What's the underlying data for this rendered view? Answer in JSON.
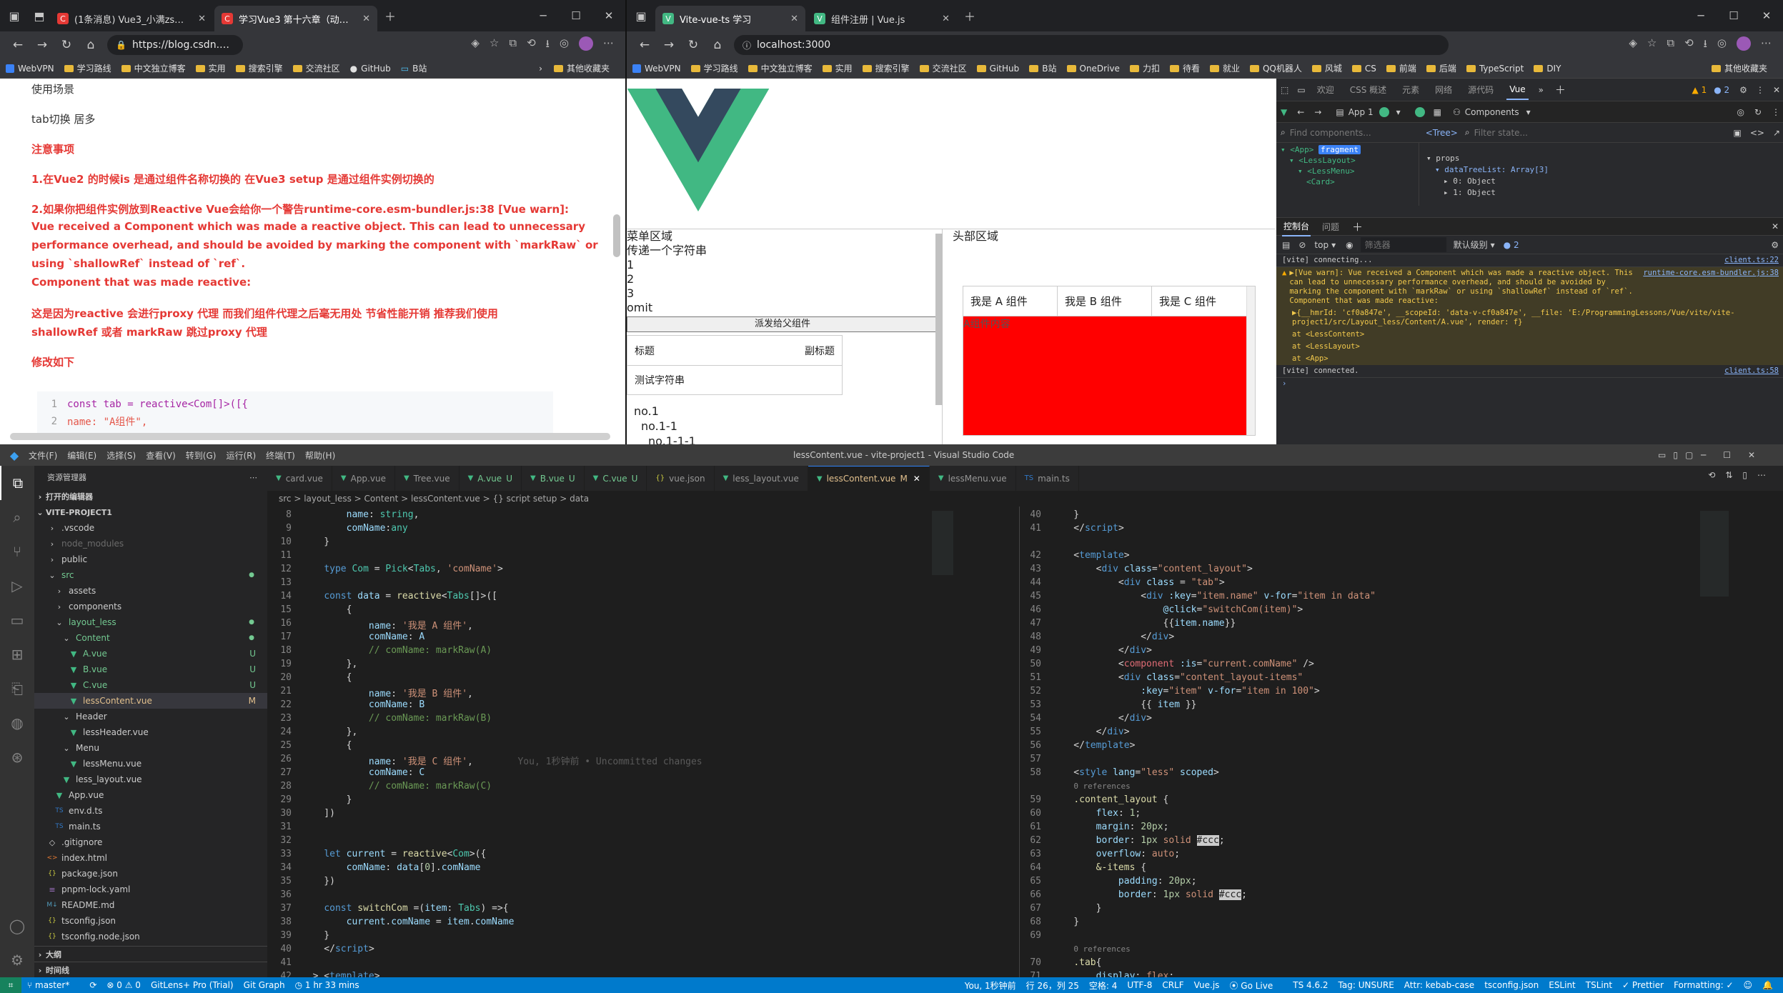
{
  "left_browser": {
    "tabs": [
      {
        "label": "(1条消息) Vue3_小满zs的博客-CS",
        "fav": "C"
      },
      {
        "label": "学习Vue3 第十六章（动态组件）",
        "fav": "C"
      }
    ],
    "url": "https://blog.csdn.net/...",
    "bookmarks": [
      "WebVPN",
      "学习路线",
      "中文独立博客",
      "实用",
      "搜索引擎",
      "交流社区",
      "GitHub",
      "B站"
    ],
    "other_bookmarks": "其他收藏夹"
  },
  "article": {
    "usage_title": "使用场景",
    "usage_text": "tab切换 居多",
    "notice_title": "注意事项",
    "note1": "1.在Vue2 的时候is 是通过组件名称切换的 在Vue3 setup 是通过组件实例切换的",
    "note2_lines": [
      "2.如果你把组件实例放到Reactive Vue会给你一个警告runtime-core.esm-bundler.js:38 [Vue warn]:",
      "Vue received a Component which was made a reactive object. This can lead to unnecessary",
      "performance overhead, and should be avoided by marking the component with `markRaw` or",
      "using `shallowRef` instead of `ref`.",
      "Component that was made reactive:"
    ],
    "note3_lines": [
      "这是因为reactive 会进行proxy 代理 而我们组件代理之后毫无用处 节省性能开销 推荐我们使用",
      "shallowRef 或者  markRaw 跳过proxy 代理"
    ],
    "modify": "修改如下",
    "code_lines": [
      "const tab = reactive<Com[]>([{",
      "    name: \"A组件\","
    ],
    "code_nums": [
      "1",
      "2"
    ]
  },
  "right_browser": {
    "tabs": [
      {
        "label": "Vite-vue-ts 学习"
      },
      {
        "label": "组件注册 | Vue.js"
      }
    ],
    "url": "localhost:3000",
    "bookmarks": [
      "WebVPN",
      "学习路线",
      "中文独立博客",
      "实用",
      "搜索引擎",
      "交流社区",
      "GitHub",
      "B站",
      "OneDrive",
      "力扣",
      "待看",
      "就业",
      "QQ机器人",
      "风城",
      "CS",
      "前端",
      "后端",
      "TypeScript",
      "DIY"
    ],
    "other_bookmarks": "其他收藏夹"
  },
  "app": {
    "menu_area": "菜单区域",
    "pass_string": "传递一个字符串",
    "items": [
      "1",
      "2",
      "3"
    ],
    "omit": "omit",
    "dispatch_button": "派发给父组件",
    "card_title": "标题",
    "card_subtitle": "副标题",
    "card_body": "测试字符串",
    "tree": [
      "no.1",
      "no.1-1",
      "no.1-1-1"
    ],
    "header_area": "头部区域",
    "tabs": [
      "我是 A 组件",
      "我是 B 组件",
      "我是 C 组件"
    ],
    "content_text": "A组件内容",
    "content_color": "#ff0000"
  },
  "devtools": {
    "top_tabs": [
      "欢迎",
      "CSS 概述",
      "元素",
      "网络",
      "源代码",
      "Vue"
    ],
    "warn_count": "1",
    "info_count": "2",
    "app_selector": "App 1",
    "components_label": "Components",
    "find_placeholder": "Find components...",
    "tree_label": "<Tree>",
    "filter_placeholder": "Filter state...",
    "comp_tree": [
      "<App>",
      "<LessLayout>",
      "<LessMenu>",
      "<Card>"
    ],
    "fragment_badge": "fragment",
    "props_label": "props",
    "props": [
      "dataTreeList: Array[3]",
      "0: Object",
      "1: Object"
    ],
    "drawer_tabs": [
      "控制台",
      "问题"
    ],
    "top_context": "top",
    "filter_label": "筛选器",
    "level_label": "默认级别",
    "issue_count": "2",
    "console": [
      {
        "text": "[vite] connecting...",
        "src": "client.ts:22",
        "type": "log"
      },
      {
        "text": "▶[Vue warn]: Vue received a Component which was made a reactive object. This can lead to unnecessary performance overhead, and should be avoided by marking the component with `markRaw` or using `shallowRef` instead of `ref`. Component that was made reactive:",
        "src": "runtime-core.esm-bundler.js:38",
        "type": "warn"
      },
      {
        "text": "▶{__hmrId: 'cf0a847e', __scopeId: 'data-v-cf0a847e', __file: 'E:/ProgrammingLessons/Vue/vite/vite-project1/src/Layout_less/Content/A.vue', render: f}",
        "src": "",
        "type": "warn-sub"
      },
      {
        "text": "at <LessContent>",
        "src": "",
        "type": "warn-sub"
      },
      {
        "text": "at <LessLayout>",
        "src": "",
        "type": "warn-sub"
      },
      {
        "text": "at <App>",
        "src": "",
        "type": "warn-sub"
      },
      {
        "text": "[vite] connected.",
        "src": "client.ts:58",
        "type": "log"
      }
    ]
  },
  "vscode": {
    "menu": [
      "文件(F)",
      "编辑(E)",
      "选择(S)",
      "查看(V)",
      "转到(G)",
      "运行(R)",
      "终端(T)",
      "帮助(H)"
    ],
    "title": "lessContent.vue - vite-project1 - Visual Studio Code",
    "explorer_title": "资源管理器",
    "open_editors": "打开的编辑器",
    "project": "VITE-PROJECT1",
    "tree": [
      {
        "label": ".vscode",
        "d": 1,
        "kind": "folder"
      },
      {
        "label": "node_modules",
        "d": 1,
        "kind": "folder",
        "dim": true
      },
      {
        "label": "public",
        "d": 1,
        "kind": "folder"
      },
      {
        "label": "src",
        "d": 1,
        "kind": "folder-open",
        "color": "#73c991"
      },
      {
        "label": "assets",
        "d": 2,
        "kind": "folder"
      },
      {
        "label": "components",
        "d": 2,
        "kind": "folder"
      },
      {
        "label": "layout_less",
        "d": 2,
        "kind": "folder-open",
        "color": "#73c991"
      },
      {
        "label": "Content",
        "d": 3,
        "kind": "folder-open",
        "color": "#73c991"
      },
      {
        "label": "A.vue",
        "d": 4,
        "kind": "vue",
        "badge": "U",
        "color": "#73c991"
      },
      {
        "label": "B.vue",
        "d": 4,
        "kind": "vue",
        "badge": "U",
        "color": "#73c991"
      },
      {
        "label": "C.vue",
        "d": 4,
        "kind": "vue",
        "badge": "U",
        "color": "#73c991"
      },
      {
        "label": "lessContent.vue",
        "d": 4,
        "kind": "vue",
        "badge": "M",
        "color": "#e2c08d",
        "selected": true
      },
      {
        "label": "Header",
        "d": 3,
        "kind": "folder-open"
      },
      {
        "label": "lessHeader.vue",
        "d": 4,
        "kind": "vue"
      },
      {
        "label": "Menu",
        "d": 3,
        "kind": "folder-open"
      },
      {
        "label": "lessMenu.vue",
        "d": 4,
        "kind": "vue"
      },
      {
        "label": "less_layout.vue",
        "d": 3,
        "kind": "vue"
      },
      {
        "label": "App.vue",
        "d": 2,
        "kind": "vue"
      },
      {
        "label": "env.d.ts",
        "d": 2,
        "kind": "ts"
      },
      {
        "label": "main.ts",
        "d": 2,
        "kind": "ts"
      },
      {
        "label": ".gitignore",
        "d": 1,
        "kind": "file"
      },
      {
        "label": "index.html",
        "d": 1,
        "kind": "html"
      },
      {
        "label": "package.json",
        "d": 1,
        "kind": "json"
      },
      {
        "label": "pnpm-lock.yaml",
        "d": 1,
        "kind": "yaml"
      },
      {
        "label": "README.md",
        "d": 1,
        "kind": "md"
      },
      {
        "label": "tsconfig.json",
        "d": 1,
        "kind": "json"
      },
      {
        "label": "tsconfig.node.json",
        "d": 1,
        "kind": "json"
      }
    ],
    "outline": "大纲",
    "timeline": "时间线",
    "tabs": [
      {
        "label": "card.vue"
      },
      {
        "label": "App.vue"
      },
      {
        "label": "Tree.vue"
      },
      {
        "label": "A.vue",
        "badge": "U"
      },
      {
        "label": "B.vue",
        "badge": "U"
      },
      {
        "label": "C.vue",
        "badge": "U"
      },
      {
        "label": "vue.json"
      },
      {
        "label": "less_layout.vue"
      },
      {
        "label": "lessContent.vue",
        "badge": "M",
        "active": true
      },
      {
        "label": "lessMenu.vue"
      },
      {
        "label": "main.ts"
      }
    ],
    "breadcrumb": "src > layout_less > Content > lessContent.vue > {} script setup > data",
    "left_lines": [
      {
        "n": "8",
        "h": "        <span class=\"v\">name</span>: <span class=\"t\">string</span>,"
      },
      {
        "n": "9",
        "h": "        <span class=\"v\">comName</span>:<span class=\"t\">any</span>"
      },
      {
        "n": "10",
        "h": "    }"
      },
      {
        "n": "11",
        "h": ""
      },
      {
        "n": "12",
        "h": "    <span class=\"k\">type</span> <span class=\"t\">Com</span> = <span class=\"t\">Pick</span>&lt;<span class=\"t\">Tabs</span>, <span class=\"s\">'comName'</span>&gt;"
      },
      {
        "n": "13",
        "h": ""
      },
      {
        "n": "14",
        "h": "    <span class=\"k\">const</span> <span class=\"v\">data</span> = <span class=\"f\">reactive</span>&lt;<span class=\"t\">Tabs</span>[]&gt;([ "
      },
      {
        "n": "15",
        "h": "        {"
      },
      {
        "n": "16",
        "h": "            <span class=\"v\">name</span>: <span class=\"s\">'我是 A 组件'</span>,"
      },
      {
        "n": "17",
        "h": "            <span class=\"v\">comName</span>: <span class=\"v\">A</span>"
      },
      {
        "n": "18",
        "h": "            <span class=\"c\">// comName: markRaw(A)</span>"
      },
      {
        "n": "19",
        "h": "        },"
      },
      {
        "n": "20",
        "h": "        {"
      },
      {
        "n": "21",
        "h": "            <span class=\"v\">name</span>: <span class=\"s\">'我是 B 组件'</span>,"
      },
      {
        "n": "22",
        "h": "            <span class=\"v\">comName</span>: <span class=\"v\">B</span>"
      },
      {
        "n": "23",
        "h": "            <span class=\"c\">// comName: markRaw(B)</span>"
      },
      {
        "n": "24",
        "h": "        },"
      },
      {
        "n": "25",
        "h": "        {"
      },
      {
        "n": "26",
        "h": "            <span class=\"v\">name</span>: <span class=\"s\">'我是 C 组件'</span>,        <span style=\"color:#5a5a5a\">You, 1秒钟前 • Uncommitted changes</span>"
      },
      {
        "n": "27",
        "h": "            <span class=\"v\">comName</span>: <span class=\"v\">C</span>"
      },
      {
        "n": "28",
        "h": "            <span class=\"c\">// comName: markRaw(C)</span>"
      },
      {
        "n": "29",
        "h": "        }"
      },
      {
        "n": "30",
        "h": "    ])"
      },
      {
        "n": "31",
        "h": ""
      },
      {
        "n": "32",
        "h": ""
      },
      {
        "n": "33",
        "h": "    <span class=\"k\">let</span> <span class=\"v\">current</span> = <span class=\"f\">reactive</span>&lt;<span class=\"t\">Com</span>&gt;({"
      },
      {
        "n": "34",
        "h": "        <span class=\"v\">comName</span>: <span class=\"v\">data</span>[<span class=\"n\">0</span>].<span class=\"v\">comName</span>"
      },
      {
        "n": "35",
        "h": "    })"
      },
      {
        "n": "36",
        "h": ""
      },
      {
        "n": "37",
        "h": "    <span class=\"k\">const</span> <span class=\"f\">switchCom</span> =(<span class=\"v\">item</span>: <span class=\"t\">Tabs</span>) =&gt;{"
      },
      {
        "n": "38",
        "h": "        <span class=\"v\">current</span>.<span class=\"v\">comName</span> = <span class=\"v\">item</span>.<span class=\"v\">comName</span>"
      },
      {
        "n": "39",
        "h": "    }"
      },
      {
        "n": "40",
        "h": "    &lt;/<span class=\"tag\">script</span>&gt;"
      },
      {
        "n": "41",
        "h": ""
      },
      {
        "n": "42",
        "h": "  &gt; &lt;<span class=\"tag\">template</span>&gt;..."
      }
    ],
    "right_lines": [
      {
        "n": "40",
        "h": "    }"
      },
      {
        "n": "41",
        "h": "    &lt;/<span class=\"tag\">script</span>&gt;"
      },
      {
        "n": "",
        "h": ""
      },
      {
        "n": "42",
        "h": "    &lt;<span class=\"tag\">template</span>&gt;"
      },
      {
        "n": "43",
        "h": "        &lt;<span class=\"tag\">div</span> <span class=\"attr\">class</span>=<span class=\"s\">\"content_layout\"</span>&gt;"
      },
      {
        "n": "44",
        "h": "            &lt;<span class=\"tag\">div</span> <span class=\"attr\">class</span> = <span class=\"s\">\"tab\"</span>&gt;"
      },
      {
        "n": "45",
        "h": "                &lt;<span class=\"tag\">div</span> <span class=\"attr\">:key</span>=<span class=\"s\">\"item.name\"</span> <span class=\"attr\">v-for</span>=<span class=\"s\">\"item in data\"</span>"
      },
      {
        "n": "46",
        "h": "                    <span class=\"attr\">@click</span>=<span class=\"s\">\"switchCom(item)\"</span>&gt;"
      },
      {
        "n": "47",
        "h": "                    {{<span class=\"v\">item</span>.<span class=\"v\">name</span>}}"
      },
      {
        "n": "48",
        "h": "                &lt;/<span class=\"tag\">div</span>&gt;"
      },
      {
        "n": "49",
        "h": "            &lt;/<span class=\"tag\">div</span>&gt;"
      },
      {
        "n": "50",
        "h": "            &lt;<span class=\"tag\" style=\"color:#e06c75\">component</span> <span class=\"attr\">:is</span>=<span class=\"s\">\"current.comName\"</span> /&gt;"
      },
      {
        "n": "51",
        "h": "            &lt;<span class=\"tag\">div</span> <span class=\"attr\">class</span>=<span class=\"s\">\"content_layout-items\"</span>"
      },
      {
        "n": "52",
        "h": "                <span class=\"attr\">:key</span>=<span class=\"s\">\"item\"</span> <span class=\"attr\">v-for</span>=<span class=\"s\">\"item in 100\"</span>&gt;"
      },
      {
        "n": "53",
        "h": "                {{ <span class=\"v\">item</span> }}"
      },
      {
        "n": "54",
        "h": "            &lt;/<span class=\"tag\">div</span>&gt;"
      },
      {
        "n": "55",
        "h": "        &lt;/<span class=\"tag\">div</span>&gt;"
      },
      {
        "n": "56",
        "h": "    &lt;/<span class=\"tag\">template</span>&gt;"
      },
      {
        "n": "57",
        "h": ""
      },
      {
        "n": "58",
        "h": "    &lt;<span class=\"tag\">style</span> <span class=\"attr\">lang</span>=<span class=\"s\">\"less\"</span> <span class=\"attr\">scoped</span>&gt;"
      },
      {
        "n": "",
        "h": "    <span style=\"color:#858585;font-size:11px\">0 references</span>"
      },
      {
        "n": "59",
        "h": "    <span class=\"f\">.content_layout</span> {"
      },
      {
        "n": "60",
        "h": "        <span class=\"v\">flex</span>: <span class=\"n\">1</span>;"
      },
      {
        "n": "61",
        "h": "        <span class=\"v\">margin</span>: <span class=\"n\">20px</span>;"
      },
      {
        "n": "62",
        "h": "        <span class=\"v\">border</span>: <span class=\"n\">1px</span> <span class=\"s\">solid</span> <span style=\"background:#ccc;color:#222\">#ccc</span>;"
      },
      {
        "n": "63",
        "h": "        <span class=\"v\">overflow</span>: <span class=\"s\">auto</span>;"
      },
      {
        "n": "64",
        "h": "        <span class=\"f\">&amp;-items</span> {"
      },
      {
        "n": "65",
        "h": "            <span class=\"v\">padding</span>: <span class=\"n\">20px</span>;"
      },
      {
        "n": "66",
        "h": "            <span class=\"v\">border</span>: <span class=\"n\">1px</span> <span class=\"s\">solid</span> <span style=\"background:#ccc;color:#222\">#ccc</span>;"
      },
      {
        "n": "67",
        "h": "        }"
      },
      {
        "n": "68",
        "h": "    }"
      },
      {
        "n": "69",
        "h": ""
      },
      {
        "n": "",
        "h": "    <span style=\"color:#858585;font-size:11px\">0 references</span>"
      },
      {
        "n": "70",
        "h": "    <span class=\"f\">.tab</span>{"
      },
      {
        "n": "71",
        "h": "        <span class=\"v\">display</span>: <span class=\"s\">flex</span>;"
      }
    ],
    "status": {
      "branch": "master*",
      "errors": "⊗ 0 ⚠ 0",
      "gitlens": "GitLens+ Pro (Trial)",
      "gitgraph": "Git Graph",
      "time": "1 hr 33 mins",
      "blame": "You, 1秒钟前",
      "pos": "行 26，列 25",
      "spaces": "空格: 4",
      "enc": "UTF-8",
      "eol": "CRLF",
      "lang": "Vue.js",
      "golive": "Go Live",
      "ts": "TS 4.6.2",
      "tag": "Tag: UNSURE",
      "attr": "Attr: kebab-case",
      "tsconfig": "tsconfig.json",
      "eslint": "ESLint",
      "tslint": "TSLint",
      "prettier": "✓ Prettier",
      "formatting": "Formatting: ✓"
    }
  }
}
